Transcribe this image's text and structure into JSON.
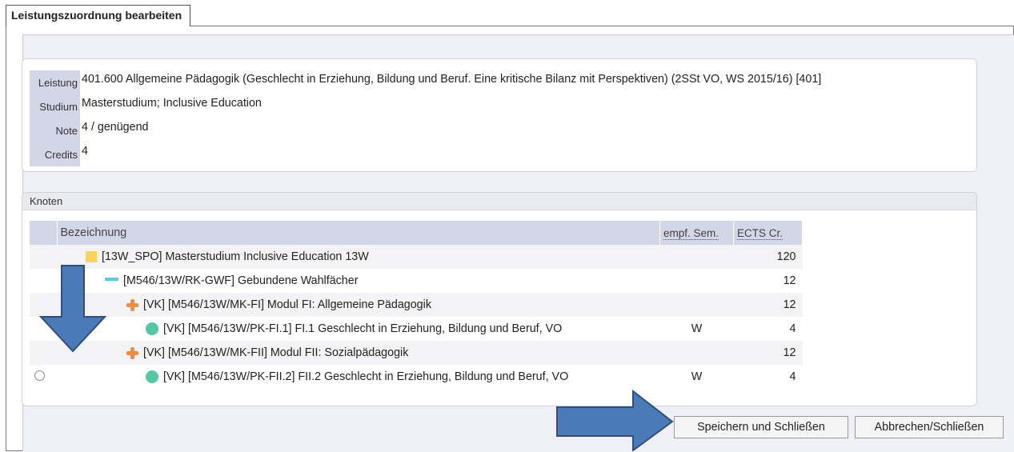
{
  "dialog": {
    "title": "Leistungszuordnung bearbeiten"
  },
  "info": {
    "rows": [
      {
        "label": "Leistung",
        "value": "401.600 Allgemeine Pädagogik (Geschlecht in Erziehung, Bildung und Beruf. Eine kritische Bilanz mit Perspektiven) (2SSt VO, WS 2015/16) [401]"
      },
      {
        "label": "Studium",
        "value": "Masterstudium; Inclusive Education"
      },
      {
        "label": "Note",
        "value": "4 / genügend"
      },
      {
        "label": "Credits",
        "value": "4"
      }
    ]
  },
  "knoten": {
    "title": "Knoten",
    "columns": {
      "name": "Bezeichnung",
      "sem": "empf. Sem.",
      "ects": "ECTS Cr."
    },
    "rows": [
      {
        "icon": "yellow-square-icon",
        "name": "[13W_SPO] Masterstudium Inclusive Education 13W",
        "sem": "",
        "ects": "120"
      },
      {
        "icon": "cyan-dash-icon",
        "name": "[M546/13W/RK-GWF] Gebundene Wahlfächer",
        "sem": "",
        "ects": "12"
      },
      {
        "icon": "orange-cross-icon",
        "name": "[VK] [M546/13W/MK-FI] Modul FI: Allgemeine Pädagogik",
        "sem": "",
        "ects": "12"
      },
      {
        "icon": "green-dot-icon",
        "name": "[VK] [M546/13W/PK-FI.1] FI.1 Geschlecht in Erziehung, Bildung und Beruf, VO",
        "sem": "W",
        "ects": "4"
      },
      {
        "icon": "orange-cross-icon",
        "name": "[VK] [M546/13W/MK-FII] Modul FII: Sozialpädagogik",
        "sem": "",
        "ects": "12"
      },
      {
        "icon": "green-dot-icon",
        "name": "[VK] [M546/13W/PK-FII.2] FII.2 Geschlecht in Erziehung, Bildung und Beruf, VO",
        "sem": "W",
        "ects": "4"
      }
    ]
  },
  "buttons": {
    "save": "Speichern und Schließen",
    "cancel": "Abbrechen/Schließen"
  },
  "colors": {
    "arrow": "#4a7ab8",
    "arrow_stroke": "#2f4f7a",
    "label_bg": "#d2d6e7"
  }
}
